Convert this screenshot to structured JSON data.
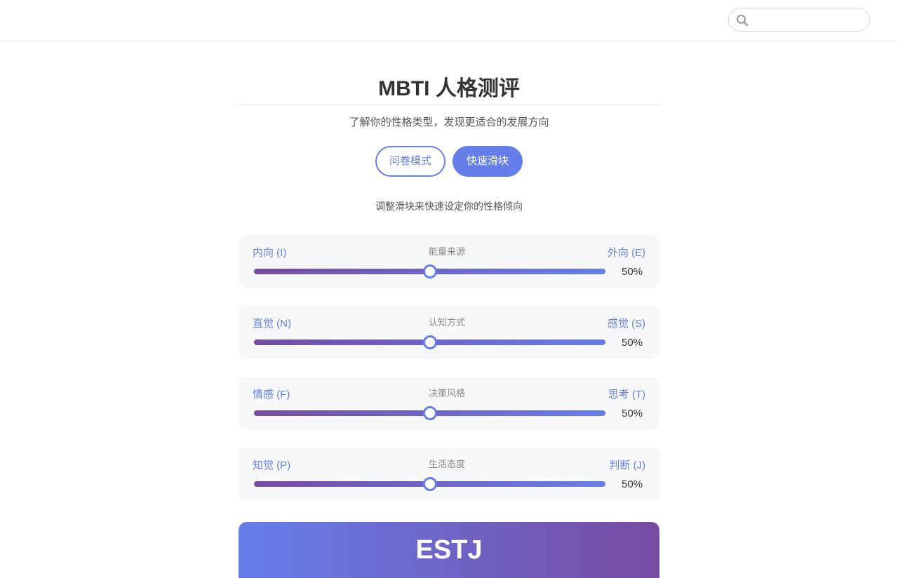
{
  "search": {
    "placeholder": "",
    "value": ""
  },
  "header": {
    "title": "MBTI 人格测评",
    "subtitle": "了解你的性格类型，发现更适合的发展方向"
  },
  "modes": {
    "questionnaire_label": "问卷模式",
    "slider_label": "快速滑块",
    "active": "快速滑块"
  },
  "hint": "调整滑块来快速设定你的性格倾向",
  "sliders": [
    {
      "left": "内向 (I)",
      "dimension": "能量来源",
      "right": "外向 (E)",
      "value": 50,
      "value_text": "50%"
    },
    {
      "left": "直觉 (N)",
      "dimension": "认知方式",
      "right": "感觉 (S)",
      "value": 50,
      "value_text": "50%"
    },
    {
      "left": "情感 (F)",
      "dimension": "决策风格",
      "right": "思考 (T)",
      "value": 50,
      "value_text": "50%"
    },
    {
      "left": "知觉 (P)",
      "dimension": "生活态度",
      "right": "判断 (J)",
      "value": 50,
      "value_text": "50%"
    }
  ],
  "result": {
    "type": "ESTJ"
  },
  "colors": {
    "accent": "#667eea",
    "accent_dark": "#764ba2",
    "card_bg": "#f7f8fa"
  },
  "icons": {
    "search": "search-icon"
  }
}
